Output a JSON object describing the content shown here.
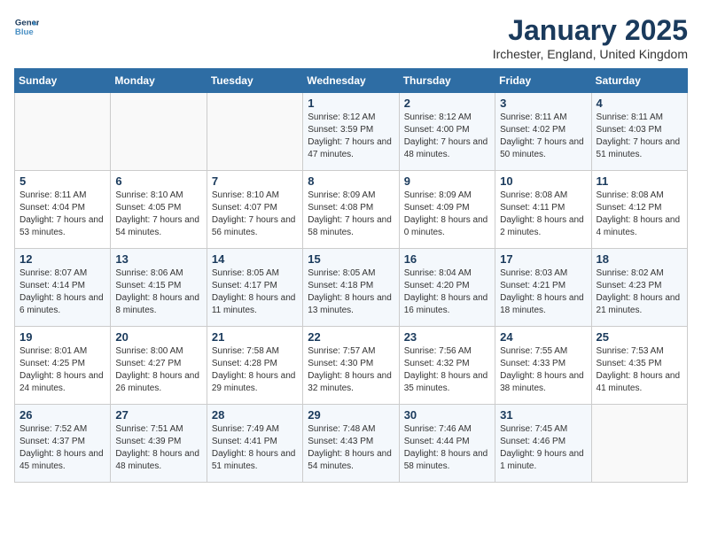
{
  "header": {
    "logo_line1": "General",
    "logo_line2": "Blue",
    "month": "January 2025",
    "location": "Irchester, England, United Kingdom"
  },
  "weekdays": [
    "Sunday",
    "Monday",
    "Tuesday",
    "Wednesday",
    "Thursday",
    "Friday",
    "Saturday"
  ],
  "weeks": [
    [
      {
        "day": "",
        "text": ""
      },
      {
        "day": "",
        "text": ""
      },
      {
        "day": "",
        "text": ""
      },
      {
        "day": "1",
        "text": "Sunrise: 8:12 AM\nSunset: 3:59 PM\nDaylight: 7 hours and 47 minutes."
      },
      {
        "day": "2",
        "text": "Sunrise: 8:12 AM\nSunset: 4:00 PM\nDaylight: 7 hours and 48 minutes."
      },
      {
        "day": "3",
        "text": "Sunrise: 8:11 AM\nSunset: 4:02 PM\nDaylight: 7 hours and 50 minutes."
      },
      {
        "day": "4",
        "text": "Sunrise: 8:11 AM\nSunset: 4:03 PM\nDaylight: 7 hours and 51 minutes."
      }
    ],
    [
      {
        "day": "5",
        "text": "Sunrise: 8:11 AM\nSunset: 4:04 PM\nDaylight: 7 hours and 53 minutes."
      },
      {
        "day": "6",
        "text": "Sunrise: 8:10 AM\nSunset: 4:05 PM\nDaylight: 7 hours and 54 minutes."
      },
      {
        "day": "7",
        "text": "Sunrise: 8:10 AM\nSunset: 4:07 PM\nDaylight: 7 hours and 56 minutes."
      },
      {
        "day": "8",
        "text": "Sunrise: 8:09 AM\nSunset: 4:08 PM\nDaylight: 7 hours and 58 minutes."
      },
      {
        "day": "9",
        "text": "Sunrise: 8:09 AM\nSunset: 4:09 PM\nDaylight: 8 hours and 0 minutes."
      },
      {
        "day": "10",
        "text": "Sunrise: 8:08 AM\nSunset: 4:11 PM\nDaylight: 8 hours and 2 minutes."
      },
      {
        "day": "11",
        "text": "Sunrise: 8:08 AM\nSunset: 4:12 PM\nDaylight: 8 hours and 4 minutes."
      }
    ],
    [
      {
        "day": "12",
        "text": "Sunrise: 8:07 AM\nSunset: 4:14 PM\nDaylight: 8 hours and 6 minutes."
      },
      {
        "day": "13",
        "text": "Sunrise: 8:06 AM\nSunset: 4:15 PM\nDaylight: 8 hours and 8 minutes."
      },
      {
        "day": "14",
        "text": "Sunrise: 8:05 AM\nSunset: 4:17 PM\nDaylight: 8 hours and 11 minutes."
      },
      {
        "day": "15",
        "text": "Sunrise: 8:05 AM\nSunset: 4:18 PM\nDaylight: 8 hours and 13 minutes."
      },
      {
        "day": "16",
        "text": "Sunrise: 8:04 AM\nSunset: 4:20 PM\nDaylight: 8 hours and 16 minutes."
      },
      {
        "day": "17",
        "text": "Sunrise: 8:03 AM\nSunset: 4:21 PM\nDaylight: 8 hours and 18 minutes."
      },
      {
        "day": "18",
        "text": "Sunrise: 8:02 AM\nSunset: 4:23 PM\nDaylight: 8 hours and 21 minutes."
      }
    ],
    [
      {
        "day": "19",
        "text": "Sunrise: 8:01 AM\nSunset: 4:25 PM\nDaylight: 8 hours and 24 minutes."
      },
      {
        "day": "20",
        "text": "Sunrise: 8:00 AM\nSunset: 4:27 PM\nDaylight: 8 hours and 26 minutes."
      },
      {
        "day": "21",
        "text": "Sunrise: 7:58 AM\nSunset: 4:28 PM\nDaylight: 8 hours and 29 minutes."
      },
      {
        "day": "22",
        "text": "Sunrise: 7:57 AM\nSunset: 4:30 PM\nDaylight: 8 hours and 32 minutes."
      },
      {
        "day": "23",
        "text": "Sunrise: 7:56 AM\nSunset: 4:32 PM\nDaylight: 8 hours and 35 minutes."
      },
      {
        "day": "24",
        "text": "Sunrise: 7:55 AM\nSunset: 4:33 PM\nDaylight: 8 hours and 38 minutes."
      },
      {
        "day": "25",
        "text": "Sunrise: 7:53 AM\nSunset: 4:35 PM\nDaylight: 8 hours and 41 minutes."
      }
    ],
    [
      {
        "day": "26",
        "text": "Sunrise: 7:52 AM\nSunset: 4:37 PM\nDaylight: 8 hours and 45 minutes."
      },
      {
        "day": "27",
        "text": "Sunrise: 7:51 AM\nSunset: 4:39 PM\nDaylight: 8 hours and 48 minutes."
      },
      {
        "day": "28",
        "text": "Sunrise: 7:49 AM\nSunset: 4:41 PM\nDaylight: 8 hours and 51 minutes."
      },
      {
        "day": "29",
        "text": "Sunrise: 7:48 AM\nSunset: 4:43 PM\nDaylight: 8 hours and 54 minutes."
      },
      {
        "day": "30",
        "text": "Sunrise: 7:46 AM\nSunset: 4:44 PM\nDaylight: 8 hours and 58 minutes."
      },
      {
        "day": "31",
        "text": "Sunrise: 7:45 AM\nSunset: 4:46 PM\nDaylight: 9 hours and 1 minute."
      },
      {
        "day": "",
        "text": ""
      }
    ]
  ]
}
